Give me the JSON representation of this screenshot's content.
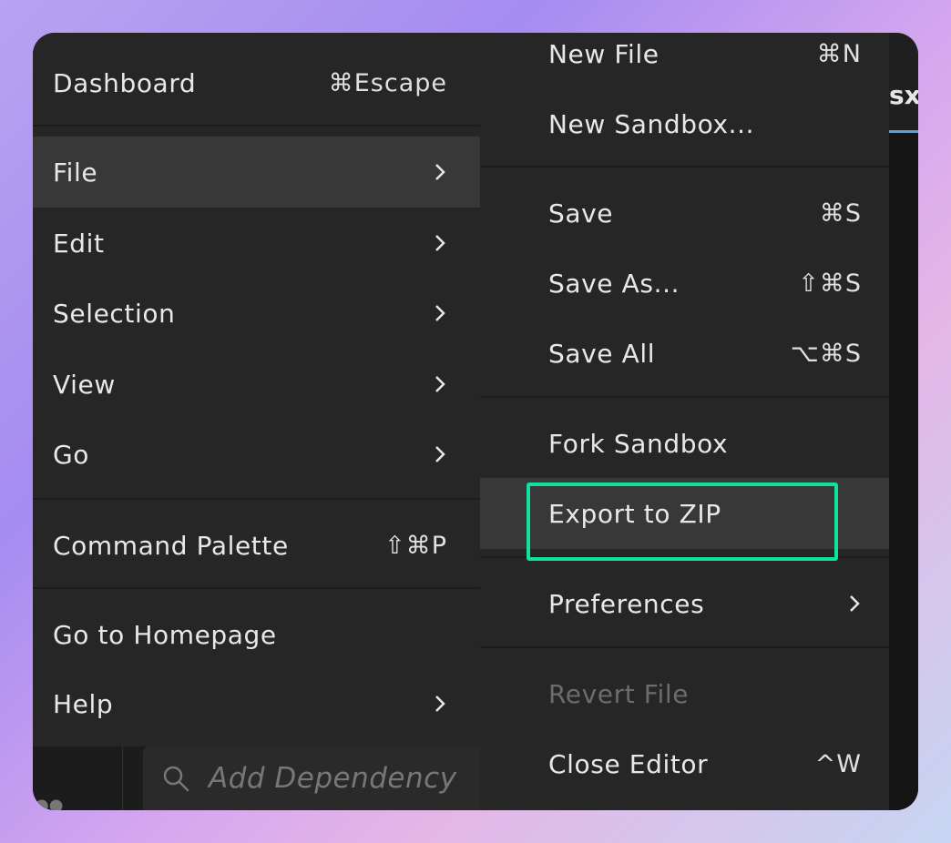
{
  "left_menu": {
    "items": [
      {
        "label": "Dashboard",
        "shortcut": "⌘Escape"
      },
      {
        "label": "File"
      },
      {
        "label": "Edit"
      },
      {
        "label": "Selection"
      },
      {
        "label": "View"
      },
      {
        "label": "Go"
      },
      {
        "label": "Command Palette",
        "shortcut": "⇧⌘P"
      },
      {
        "label": "Go to Homepage"
      },
      {
        "label": "Help"
      }
    ]
  },
  "file_submenu": {
    "items": [
      {
        "label": "New File",
        "shortcut": "⌘N"
      },
      {
        "label": "New Sandbox..."
      },
      {
        "label": "Save",
        "shortcut": "⌘S"
      },
      {
        "label": "Save As...",
        "shortcut": "⇧⌘S"
      },
      {
        "label": "Save All",
        "shortcut": "⌥⌘S"
      },
      {
        "label": "Fork Sandbox"
      },
      {
        "label": "Export to ZIP"
      },
      {
        "label": "Preferences"
      },
      {
        "label": "Revert File"
      },
      {
        "label": "Close Editor",
        "shortcut": "^W"
      }
    ]
  },
  "background": {
    "tab_partial": "sx",
    "dependency_placeholder": "Add Dependency"
  },
  "colors": {
    "highlight": "#10e0a0",
    "menu_bg": "#262626",
    "active_bg": "#383838"
  }
}
